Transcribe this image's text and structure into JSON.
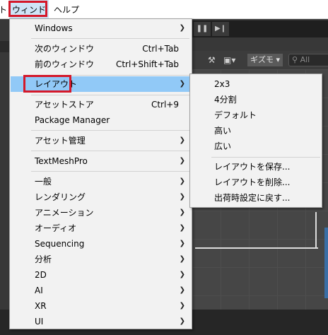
{
  "menubar": {
    "left_fragment": "ト",
    "window": "ウィンドウ",
    "help": "ヘルプ"
  },
  "toolbar": {
    "pause_icon": "pause-icon",
    "step_icon": "step-icon",
    "gizmo_label": "ギズモ",
    "search_placeholder": "All"
  },
  "menu": {
    "items": [
      {
        "label": "Windows",
        "shortcut": "",
        "submenu": true
      },
      {
        "label": "次のウィンドウ",
        "shortcut": "Ctrl+Tab",
        "submenu": false
      },
      {
        "label": "前のウィンドウ",
        "shortcut": "Ctrl+Shift+Tab",
        "submenu": false
      },
      {
        "label": "レイアウト",
        "shortcut": "",
        "submenu": true,
        "highlighted": true
      },
      {
        "label": "アセットストア",
        "shortcut": "Ctrl+9",
        "submenu": false
      },
      {
        "label": "Package Manager",
        "shortcut": "",
        "submenu": false
      },
      {
        "label": "アセット管理",
        "shortcut": "",
        "submenu": true
      },
      {
        "label": "TextMeshPro",
        "shortcut": "",
        "submenu": true
      },
      {
        "label": "一般",
        "shortcut": "",
        "submenu": true
      },
      {
        "label": "レンダリング",
        "shortcut": "",
        "submenu": true
      },
      {
        "label": "アニメーション",
        "shortcut": "",
        "submenu": true
      },
      {
        "label": "オーディオ",
        "shortcut": "",
        "submenu": true
      },
      {
        "label": "Sequencing",
        "shortcut": "",
        "submenu": true
      },
      {
        "label": "分析",
        "shortcut": "",
        "submenu": true
      },
      {
        "label": "2D",
        "shortcut": "",
        "submenu": true
      },
      {
        "label": "AI",
        "shortcut": "",
        "submenu": true
      },
      {
        "label": "XR",
        "shortcut": "",
        "submenu": true
      },
      {
        "label": "UI",
        "shortcut": "",
        "submenu": true
      }
    ]
  },
  "submenu": {
    "items": [
      {
        "label": "2x3"
      },
      {
        "label": "4分割"
      },
      {
        "label": "デフォルト"
      },
      {
        "label": "高い"
      },
      {
        "label": "広い"
      },
      {
        "label": "レイアウトを保存..."
      },
      {
        "label": "レイアウトを削除..."
      },
      {
        "label": "出荷時設定に戻す..."
      }
    ]
  },
  "colors": {
    "highlight": "#91c9f7",
    "callout_red": "#d4182a",
    "menu_bg": "#f2f2f2"
  }
}
